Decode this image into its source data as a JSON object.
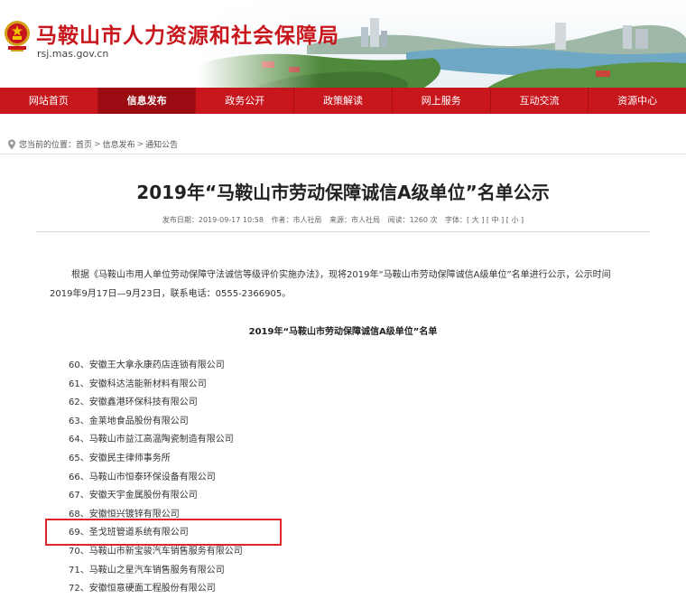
{
  "header": {
    "site_name": "马鞍山市人力资源和社会保障局",
    "domain": "rsj.mas.gov.cn"
  },
  "nav": {
    "items": [
      {
        "label": "网站首页"
      },
      {
        "label": "信息发布"
      },
      {
        "label": "政务公开"
      },
      {
        "label": "政策解读"
      },
      {
        "label": "网上服务"
      },
      {
        "label": "互动交流"
      },
      {
        "label": "资源中心"
      }
    ],
    "active_index": 1
  },
  "breadcrumb": {
    "prefix": "您当前的位置：",
    "items": [
      "首页",
      "信息发布",
      "通知公告"
    ],
    "separator": ">"
  },
  "article": {
    "title": "2019年“马鞍山市劳动保障诚信A级单位”名单公示",
    "meta": {
      "date": "发布日期：2019-09-17 10:58",
      "author": "作者：市人社局",
      "source": "来源：市人社局",
      "views": "阅读：1260 次",
      "font_size": "字体：[ 大 ] [ 中 ] [ 小 ]"
    },
    "paragraph": "根据《马鞍山市用人单位劳动保障守法诚信等级评价实施办法》，现将2019年“马鞍山市劳动保障诚信A级单位”名单进行公示，公示时间2019年9月17日—9月23日，联系电话：0555-2366905。",
    "list_title": "2019年“马鞍山市劳动保障诚信A级单位”名单",
    "list": [
      "60、安徽王大拿永康药店连锁有限公司",
      "61、安徽科达洁能新材料有限公司",
      "62、安徽鑫港环保科技有限公司",
      "63、金莱地食品股份有限公司",
      "64、马鞍山市益江高温陶瓷制造有限公司",
      "65、安徽民主律师事务所",
      "66、马鞍山市恒泰环保设备有限公司",
      "67、安徽天宇金属股份有限公司",
      "68、安徽恒兴镀锌有限公司",
      "69、圣戈班管道系统有限公司",
      "70、马鞍山市新宝骏汽车销售服务有限公司",
      "71、马鞍山之星汽车销售服务有限公司",
      "72、安徽恒意硬面工程股份有限公司"
    ],
    "highlighted_index": 9
  },
  "colors": {
    "brand_red": "#c8161d",
    "nav_active": "#9a0c11",
    "highlight_border": "#e0242c"
  },
  "icons": {
    "emblem": "national-emblem-icon",
    "breadcrumb": "location-pin-icon"
  }
}
